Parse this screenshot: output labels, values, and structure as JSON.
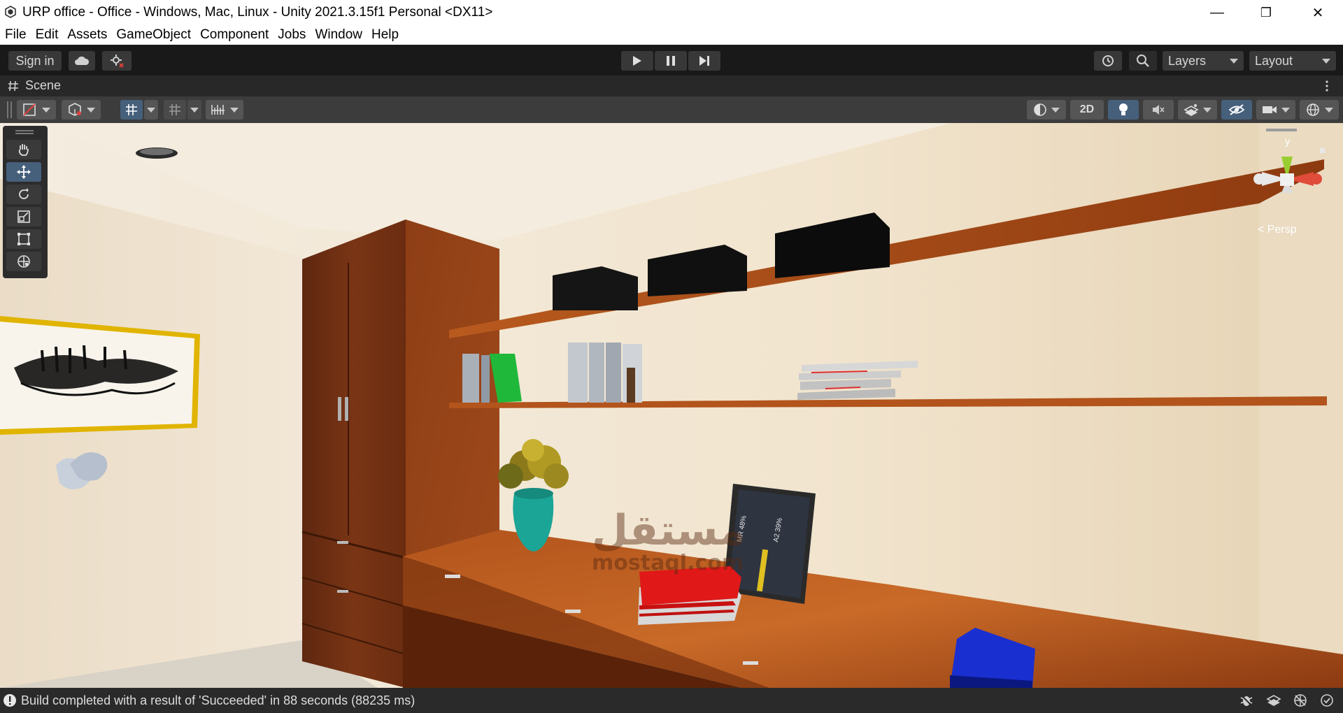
{
  "window": {
    "title": "URP office - Office - Windows, Mac, Linux - Unity 2021.3.15f1 Personal <DX11>",
    "minimize": "—",
    "maximize": "❐",
    "close": "✕"
  },
  "menu": [
    "File",
    "Edit",
    "Assets",
    "GameObject",
    "Component",
    "Jobs",
    "Window",
    "Help"
  ],
  "toolbar": {
    "sign_in": "Sign in",
    "layers": "Layers",
    "layout": "Layout"
  },
  "scene_tab": {
    "label": "Scene",
    "two_d": "2D"
  },
  "gizmo": {
    "axis_y": "y",
    "persp": "< Persp"
  },
  "watermark": {
    "arabic": "مستقل",
    "latin": "mostaql.com"
  },
  "status": {
    "message": "Build completed with a result of 'Succeeded' in 88 seconds (88235 ms)"
  },
  "colors": {
    "accent": "#46607c",
    "wall": "#efe3cf",
    "wood": "#8a3a14",
    "shelf": "#b55a20",
    "frame_gold": "#e0b400",
    "book_green": "#1fb83a",
    "book_red": "#e01818",
    "book_blue": "#1a2fd0",
    "vase": "#1aa596"
  },
  "icons": [
    "unity-logo-icon",
    "cloud-icon",
    "collab-icon",
    "play-icon",
    "pause-icon",
    "step-icon",
    "history-icon",
    "search-icon",
    "hand-icon",
    "move-icon",
    "rotate-icon",
    "scale-icon",
    "rect-icon",
    "transform-icon",
    "info-icon"
  ]
}
